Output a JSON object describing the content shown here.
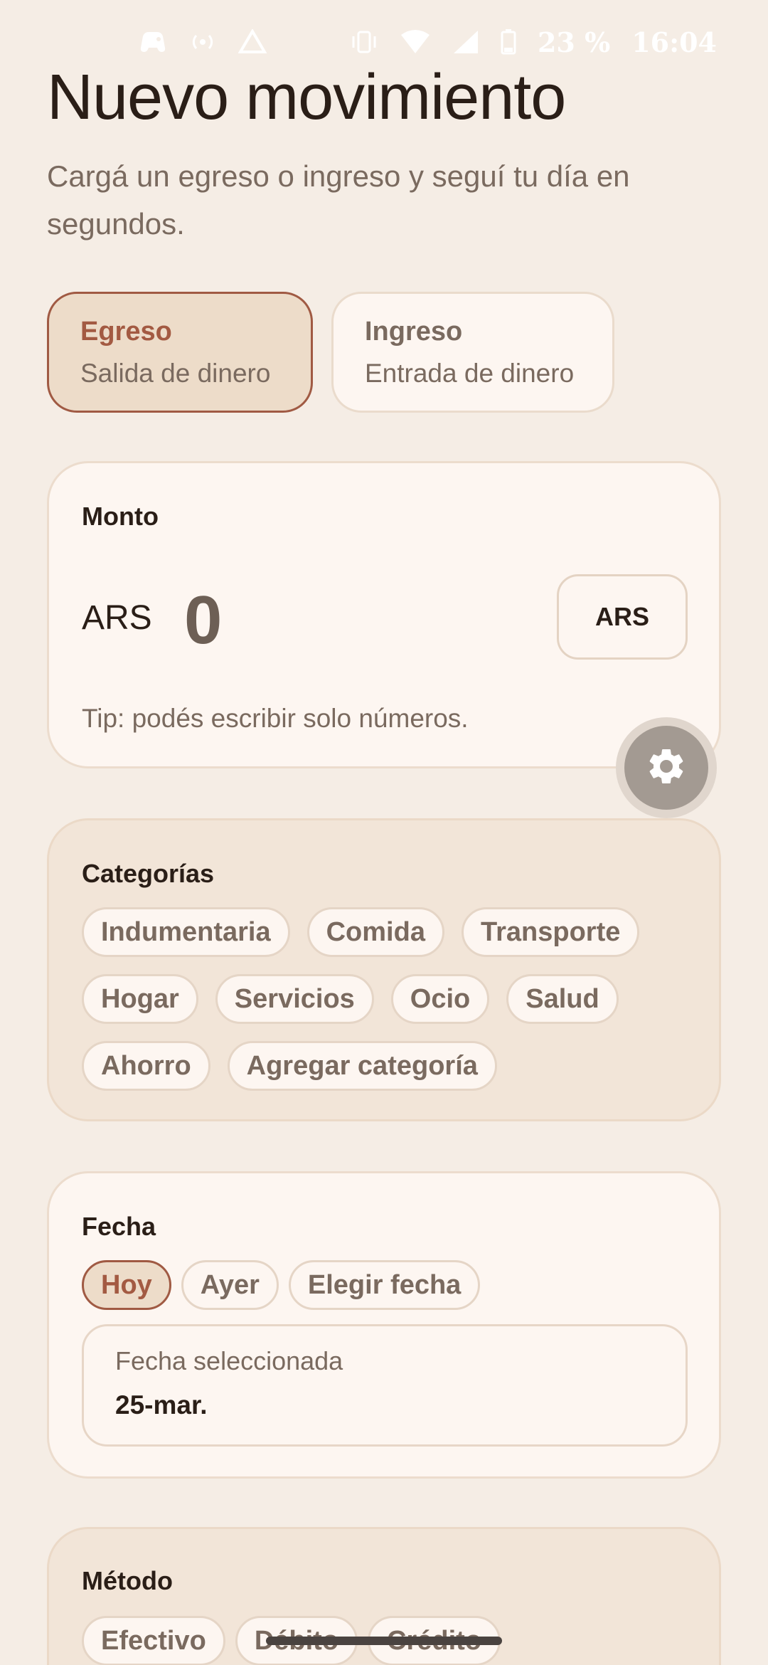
{
  "status_bar": {
    "battery": "23 %",
    "time": "16:04"
  },
  "header": {
    "title": "Nuevo movimiento",
    "subtitle": "Cargá un egreso o ingreso y seguí tu día en segundos."
  },
  "type_toggle": {
    "egreso": {
      "title": "Egreso",
      "subtitle": "Salida de dinero",
      "selected": true
    },
    "ingreso": {
      "title": "Ingreso",
      "subtitle": "Entrada de dinero",
      "selected": false
    }
  },
  "amount": {
    "label": "Monto",
    "currency_prefix": "ARS",
    "value": "0",
    "currency_button": "ARS",
    "tip": "Tip: podés escribir solo números."
  },
  "categories": {
    "label": "Categorías",
    "items": [
      "Indumentaria",
      "Comida",
      "Transporte",
      "Hogar",
      "Servicios",
      "Ocio",
      "Salud",
      "Ahorro",
      "Agregar categoría"
    ]
  },
  "date": {
    "label": "Fecha",
    "options": [
      "Hoy",
      "Ayer",
      "Elegir fecha"
    ],
    "selected_option": "Hoy",
    "selected_label": "Fecha seleccionada",
    "selected_value": "25-mar."
  },
  "method": {
    "label": "Método",
    "options": [
      "Efectivo",
      "Débito",
      "Crédito"
    ]
  },
  "colors": {
    "background": "#f5ede5",
    "accent": "#a35a42",
    "card_light": "#fdf6f1",
    "card_tan": "#f2e5d8",
    "muted_text": "#7a6a5f"
  },
  "icons": {
    "status_left": [
      "game-controller-icon",
      "hotspot-icon",
      "drive-icon"
    ],
    "status_right": [
      "vibrate-icon",
      "wifi-icon",
      "signal-icon",
      "battery-icon"
    ],
    "fab": "gear-icon"
  }
}
